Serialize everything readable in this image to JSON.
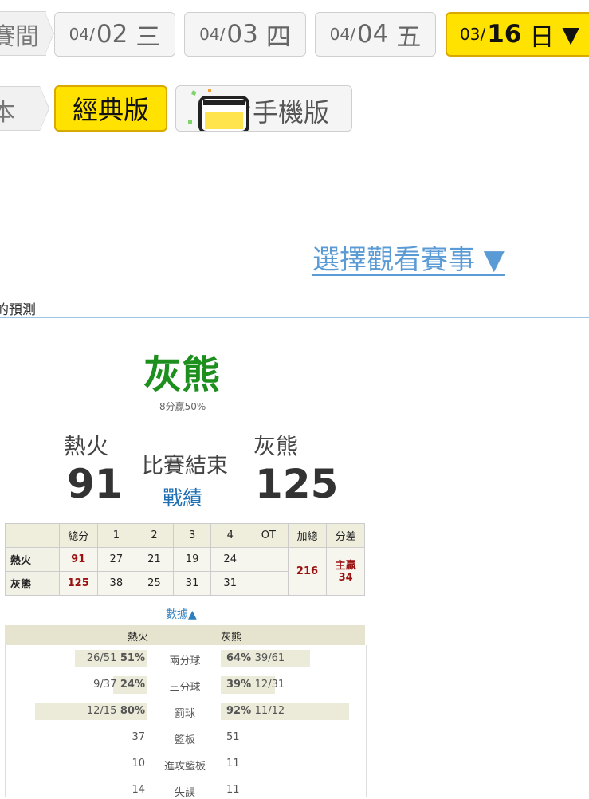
{
  "date_nav": {
    "prev_crumb": "賽間",
    "tabs": [
      {
        "md": "04/",
        "day": "02",
        "weekday": "三"
      },
      {
        "md": "04/",
        "day": "03",
        "weekday": "四"
      },
      {
        "md": "04/",
        "day": "04",
        "weekday": "五"
      }
    ],
    "active": {
      "md": "03/",
      "day": "16",
      "weekday": "日",
      "arrow": "▼"
    }
  },
  "version_nav": {
    "prev_crumb": "本",
    "classic_label": "經典版",
    "mobile_label": "手機版",
    "mobile_icon": "phone-icon"
  },
  "select_game_label": "選擇觀看賽事 ▼",
  "section_title": "的預測",
  "prediction": {
    "team": "灰熊",
    "subtitle": "8分贏50%"
  },
  "scoreboard": {
    "away": {
      "name": "熱火",
      "score": "91"
    },
    "home": {
      "name": "灰熊",
      "score": "125"
    },
    "status": "比賽結束",
    "record_link": "戰績"
  },
  "box_score": {
    "headers": [
      "",
      "總分",
      "1",
      "2",
      "3",
      "4",
      "OT",
      "加總",
      "分差"
    ],
    "rows": [
      {
        "team": "熱火",
        "total": "91",
        "q": [
          "27",
          "21",
          "19",
          "24",
          ""
        ]
      },
      {
        "team": "灰熊",
        "total": "125",
        "q": [
          "38",
          "25",
          "31",
          "31",
          ""
        ]
      }
    ],
    "sum": "216",
    "diff_line1": "主贏",
    "diff_line2": "34"
  },
  "stats": {
    "toggle_label": "數據▲",
    "away_name": "熱火",
    "home_name": "灰熊",
    "rows": [
      {
        "label": "兩分球",
        "away": "26/51",
        "away_pct": "51%",
        "home_pct": "64%",
        "home": "39/61",
        "away_frac": 0.51,
        "home_frac": 0.64
      },
      {
        "label": "三分球",
        "away": "9/37",
        "away_pct": "24%",
        "home_pct": "39%",
        "home": "12/31",
        "away_frac": 0.24,
        "home_frac": 0.39
      },
      {
        "label": "罰球",
        "away": "12/15",
        "away_pct": "80%",
        "home_pct": "92%",
        "home": "11/12",
        "away_frac": 0.8,
        "home_frac": 0.92
      },
      {
        "label": "籃板",
        "away": "37",
        "away_pct": "",
        "home_pct": "",
        "home": "51"
      },
      {
        "label": "進攻籃板",
        "away": "10",
        "away_pct": "",
        "home_pct": "",
        "home": "11"
      },
      {
        "label": "失誤",
        "away": "14",
        "away_pct": "",
        "home_pct": "",
        "home": "11"
      }
    ]
  }
}
